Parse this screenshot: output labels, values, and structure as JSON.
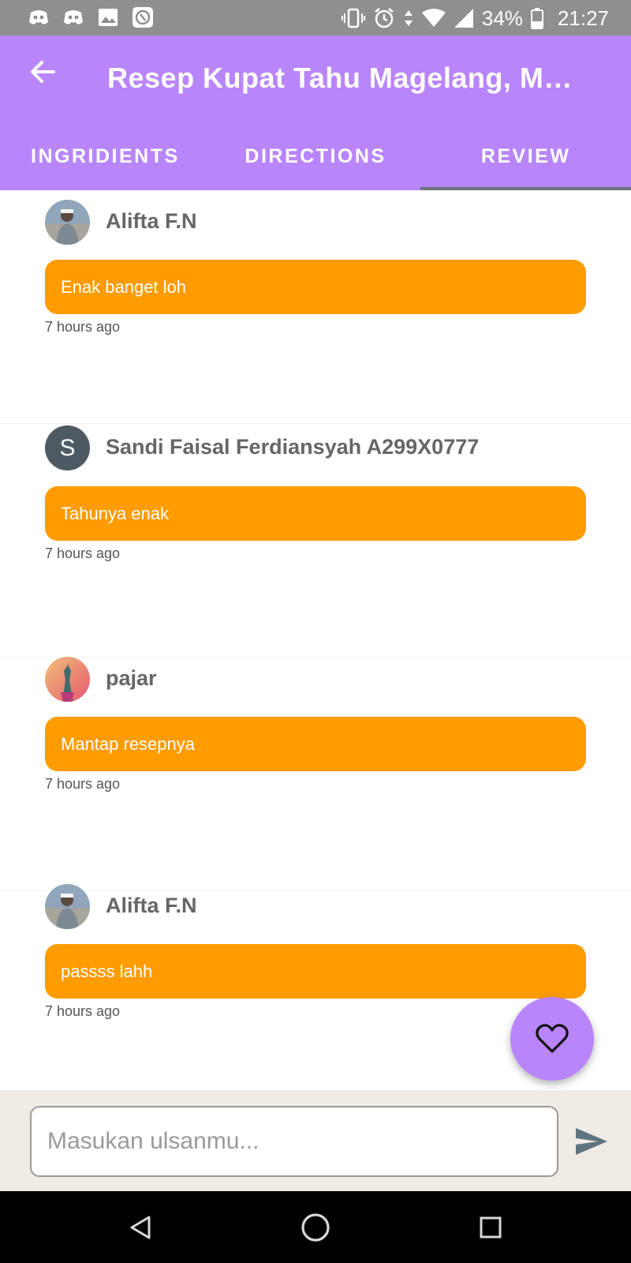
{
  "status_bar": {
    "battery": "34%",
    "time": "21:27",
    "left_icons": [
      "discord-icon",
      "discord-icon",
      "image-icon",
      "app-icon"
    ],
    "right_icons": [
      "vibrate-icon",
      "alarm-icon",
      "data-arrows-icon",
      "wifi-icon",
      "signal-icon",
      "battery-icon"
    ]
  },
  "app_bar": {
    "title": "Resep Kupat Tahu Magelang, Me…",
    "colors": {
      "primary": "#b985fb",
      "indicator": "#6b737a"
    }
  },
  "tabs": [
    {
      "label": "INGRIDIENTS",
      "active": false
    },
    {
      "label": "DIRECTIONS",
      "active": false
    },
    {
      "label": "REVIEW",
      "active": true
    }
  ],
  "reviews": [
    {
      "name": "Alifta F.N",
      "text": "Enak banget loh",
      "time": "7 hours ago",
      "avatar": "photo-avatar-a"
    },
    {
      "name": "Sandi Faisal Ferdiansyah A299X0777",
      "text": "Tahunya enak",
      "time": "7 hours ago",
      "avatar_letter": "S"
    },
    {
      "name": "pajar",
      "text": "Mantap resepnya",
      "time": "7 hours ago",
      "avatar": "photo-avatar-b"
    },
    {
      "name": "Alifta F.N",
      "text": "passss lahh",
      "time": "7 hours ago",
      "avatar": "photo-avatar-a"
    }
  ],
  "bubble_color": "#ff9c02",
  "fab": {
    "icon": "heart-icon"
  },
  "input": {
    "placeholder": "Masukan ulsanmu...",
    "value": ""
  },
  "send": {
    "icon": "send-icon"
  },
  "nav": {
    "icons": [
      "back-triangle-icon",
      "home-circle-icon",
      "recents-square-icon"
    ]
  }
}
